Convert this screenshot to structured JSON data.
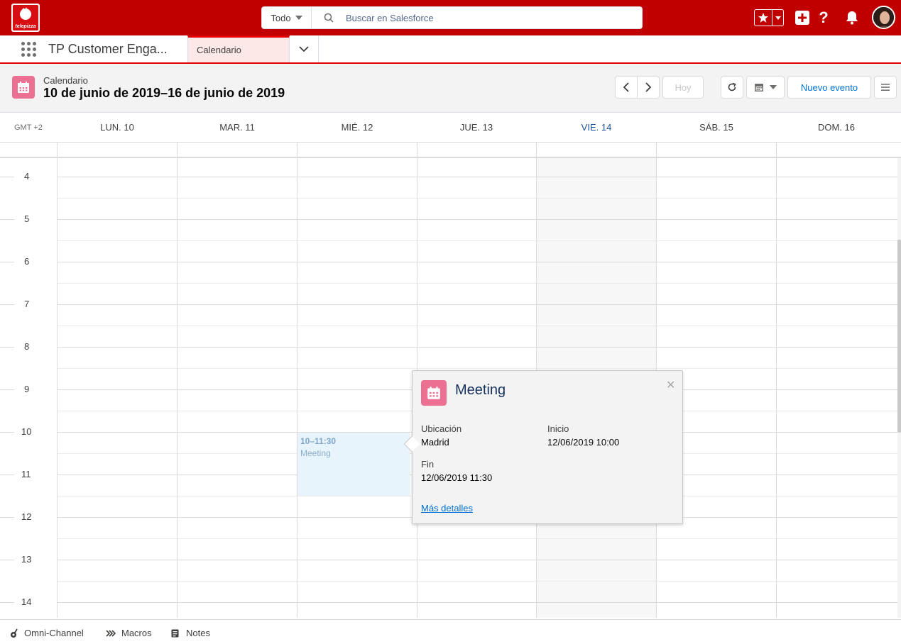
{
  "header": {
    "logo_icon": "telepizza-logo",
    "logo_text": "telepizza",
    "search_scope": "Todo",
    "search_placeholder": "Buscar en Salesforce",
    "icons": [
      "star-icon",
      "chevron-down-icon",
      "plus-icon",
      "help-icon",
      "bell-icon",
      "avatar"
    ]
  },
  "nav": {
    "app_name": "TP Customer Enga...",
    "tabs": [
      {
        "label": "Calendario",
        "active": true
      }
    ]
  },
  "page": {
    "object_label": "Calendario",
    "title": "10 de junio de 2019–16 de junio de 2019",
    "buttons": {
      "prev": "chevron-left-icon",
      "next": "chevron-right-icon",
      "today": "Hoy",
      "refresh": "refresh-icon",
      "view": "calendar-icon",
      "new_event": "Nuevo evento",
      "list": "list-icon"
    }
  },
  "calendar": {
    "timezone": "GMT +2",
    "days": [
      {
        "label": "LUN. 10",
        "today": false
      },
      {
        "label": "MAR. 11",
        "today": false
      },
      {
        "label": "MIÉ. 12",
        "today": false
      },
      {
        "label": "JUE. 13",
        "today": false
      },
      {
        "label": "VIE. 14",
        "today": true
      },
      {
        "label": "SÁB. 15",
        "today": false
      },
      {
        "label": "DOM. 16",
        "today": false
      }
    ],
    "hours": [
      "4",
      "5",
      "6",
      "7",
      "8",
      "9",
      "10",
      "11",
      "12",
      "13",
      "14"
    ],
    "today_color": "#1b5297",
    "event": {
      "time": "10–11:30",
      "title": "Meeting",
      "day_index": 2
    }
  },
  "popover": {
    "title": "Meeting",
    "location_label": "Ubicación",
    "location_value": "Madrid",
    "start_label": "Inicio",
    "start_value": "12/06/2019 10:00",
    "end_label": "Fin",
    "end_value": "12/06/2019 11:30",
    "details_link": "Más detalles",
    "close_icon": "close-icon"
  },
  "utility_bar": {
    "items": [
      {
        "label": "Omni-Channel",
        "icon": "omni-channel-icon"
      },
      {
        "label": "Macros",
        "icon": "macros-icon"
      },
      {
        "label": "Notes",
        "icon": "notes-icon"
      }
    ]
  },
  "colors": {
    "brand_red": "#c00000",
    "accent_pink": "#eb7092",
    "link_blue": "#0070d2"
  }
}
